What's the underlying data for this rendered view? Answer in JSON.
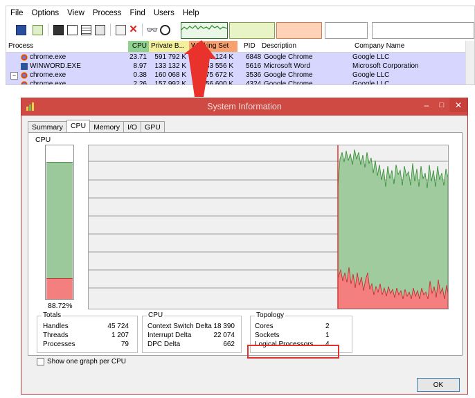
{
  "process_explorer": {
    "menu": [
      "File",
      "Options",
      "View",
      "Process",
      "Find",
      "Users",
      "Help"
    ],
    "toolbar_icons": [
      "save-icon",
      "refresh-icon",
      "window-icon",
      "properties-icon",
      "dll-icon",
      "handles-icon",
      "target-icon",
      "kill-icon",
      "find-icon",
      "crosshair-icon"
    ],
    "columns": [
      "Process",
      "CPU",
      "Private B...",
      "Working Set",
      "PID",
      "Description",
      "Company Name"
    ],
    "rows": [
      {
        "name": "chrome.exe",
        "cpu": "23.71",
        "private": "591 792 K",
        "working": "508 124 K",
        "pid": "6848",
        "desc": "Google Chrome",
        "company": "Google LLC",
        "icon": "chrome-icon"
      },
      {
        "name": "WINWORD.EXE",
        "cpu": "8.97",
        "private": "133 132 K",
        "working": "83 556 K",
        "pid": "5616",
        "desc": "Microsoft Word",
        "company": "Microsoft Corporation",
        "icon": "word-icon"
      },
      {
        "name": "chrome.exe",
        "cpu": "0.38",
        "private": "160 068 K",
        "working": "75 672 K",
        "pid": "3536",
        "desc": "Google Chrome",
        "company": "Google LLC",
        "icon": "chrome-icon"
      },
      {
        "name": "chrome.exe",
        "cpu": "2.26",
        "private": "157 992 K",
        "working": "56 600 K",
        "pid": "4324",
        "desc": "Google Chrome",
        "company": "Google LLC",
        "icon": "chrome-icon"
      }
    ]
  },
  "sysinfo": {
    "title": "System Information",
    "window_buttons": {
      "minimize": "–",
      "maximize": "□",
      "close": "✕"
    },
    "tabs": [
      "Summary",
      "CPU",
      "Memory",
      "I/O",
      "GPU"
    ],
    "active_tab": "CPU",
    "cpu_label": "CPU",
    "cpu_percent": "88.72%",
    "cpu_fraction": 0.8872,
    "kernel_fraction": 0.13,
    "totals": {
      "title": "Totals",
      "rows": [
        {
          "label": "Handles",
          "value": "45 724"
        },
        {
          "label": "Threads",
          "value": "1 207"
        },
        {
          "label": "Processes",
          "value": "79"
        }
      ]
    },
    "cpu_group": {
      "title": "CPU",
      "rows": [
        {
          "label": "Context Switch Delta",
          "value": "18 390"
        },
        {
          "label": "Interrupt Delta",
          "value": "22 074"
        },
        {
          "label": "DPC Delta",
          "value": "662"
        }
      ]
    },
    "topology": {
      "title": "Topology",
      "rows": [
        {
          "label": "Cores",
          "value": "2"
        },
        {
          "label": "Sockets",
          "value": "1"
        },
        {
          "label": "Logical Processors",
          "value": "4"
        }
      ]
    },
    "checkbox_label": "Show one graph per CPU",
    "ok_label": "OK"
  },
  "colors": {
    "title_bar": "#cf4a43",
    "cpu_green": "#9cc99c",
    "cpu_green_line": "#4f9a4f",
    "kernel_red": "#f47f7f",
    "kernel_red_line": "#d03030",
    "highlight": "#e0322c",
    "process_row": "#d6d6ff"
  }
}
